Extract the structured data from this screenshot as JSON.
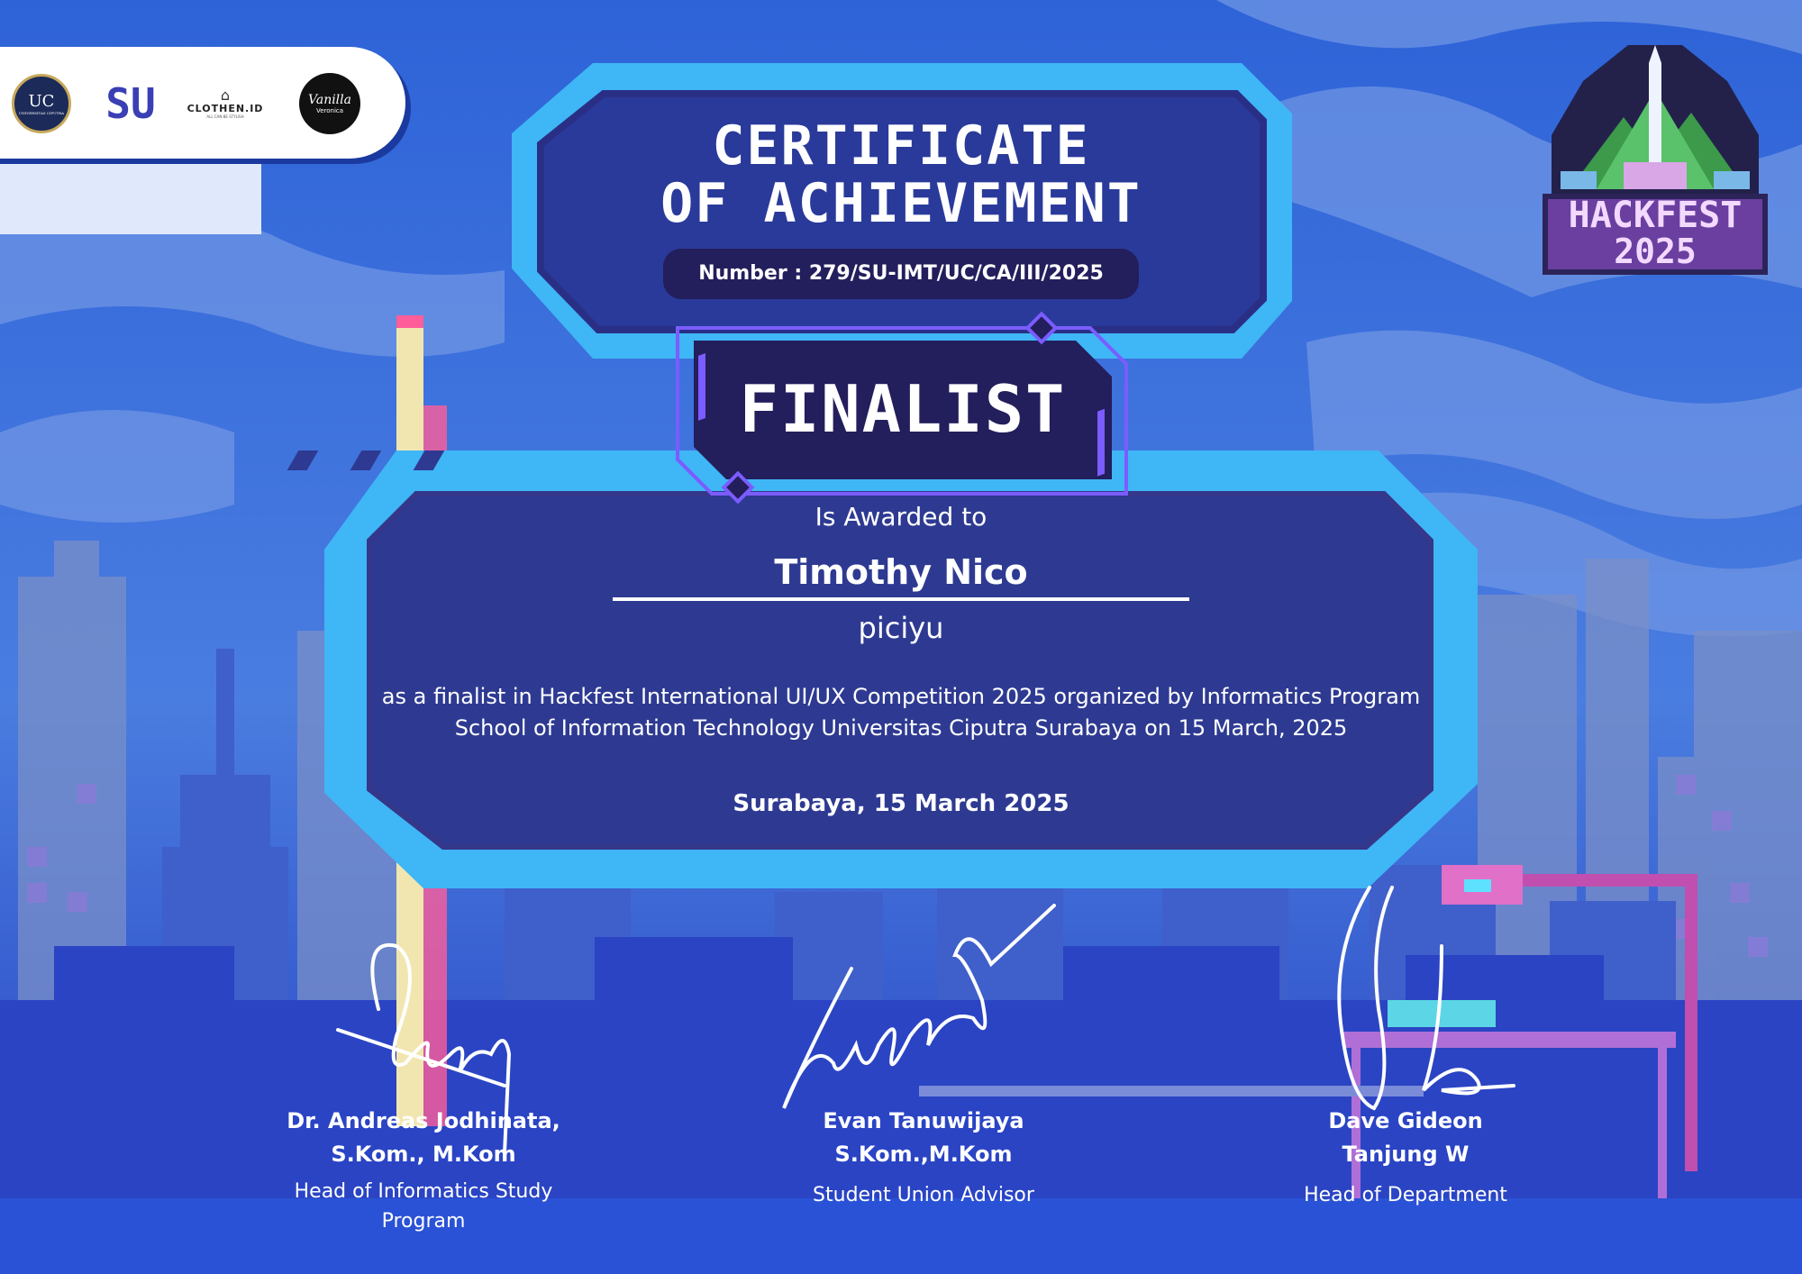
{
  "sponsors": [
    "UC",
    "UNIVERSITAS CIPUTRA",
    "SU",
    "CLOTHEN.ID",
    "ALL CAN BE STYLISH",
    "Vanilla",
    "Veronica"
  ],
  "hackfest_logo": {
    "line1": "HACKFEST",
    "line2": "2025"
  },
  "certificate": {
    "title_line1": "CERTIFICATE",
    "title_line2": "OF ACHIEVEMENT",
    "number": "Number : 279/SU-IMT/UC/CA/III/2025",
    "award": "FINALIST",
    "awarded_to": "Is Awarded to",
    "recipient_name": "Timothy Nico",
    "team_name": "piciyu",
    "description": "as a finalist in Hackfest International UI/UX Competition 2025 organized by Informatics Program School of Information Technology Universitas Ciputra Surabaya on 15 March, 2025",
    "place_date": "Surabaya, 15 March 2025"
  },
  "signatories": [
    {
      "name": "Dr. Andreas Jodhinata, S.Kom., M.Kom",
      "role": "Head of Informatics Study Program"
    },
    {
      "name": "Evan Tanuwijaya S.Kom.,M.Kom",
      "role": "Student Union Advisor"
    },
    {
      "name": "Dave Gideon Tanjung W",
      "role": "Head of Department"
    }
  ],
  "colors": {
    "sky": "#3a6fd8",
    "panel": "#2e3a92",
    "frame": "#3fb6f5",
    "dark": "#231e5c",
    "accent": "#7b5cff"
  }
}
